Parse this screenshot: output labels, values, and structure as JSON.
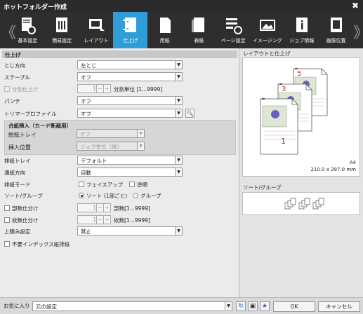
{
  "window": {
    "title": "ホットフォルダー作成",
    "close": "✖"
  },
  "tabs": [
    {
      "label": "基本設定",
      "icon": "basic-settings-icon"
    },
    {
      "label": "簡易設定",
      "icon": "quick-settings-icon"
    },
    {
      "label": "レイアウト",
      "icon": "layout-icon"
    },
    {
      "label": "仕上げ",
      "icon": "finishing-icon",
      "active": true
    },
    {
      "label": "用紙",
      "icon": "paper-icon"
    },
    {
      "label": "表紙",
      "icon": "cover-icon"
    },
    {
      "label": "ページ設定",
      "icon": "page-settings-icon"
    },
    {
      "label": "イメージング",
      "icon": "imaging-icon"
    },
    {
      "label": "ジョブ情報",
      "icon": "job-info-icon"
    },
    {
      "label": "画像位置",
      "icon": "image-position-icon"
    }
  ],
  "nav": {
    "prev": "《",
    "next": "》"
  },
  "section": {
    "title": "仕上げ"
  },
  "fields": {
    "binding": {
      "label": "とじ方向",
      "value": "左とじ"
    },
    "staple": {
      "label": "ステープル",
      "value": "オフ"
    },
    "split": {
      "label": "分割仕上げ",
      "value": "1",
      "minus": "−",
      "plus": "+",
      "unit": "分割単位 [1...9999]"
    },
    "punch": {
      "label": "パンチ",
      "value": "オフ"
    },
    "trimmer": {
      "label": "トリマープロファイル",
      "value": "オフ"
    },
    "interleave": {
      "title": "合紙挿入（カード断裁用）",
      "tray_label": "給紙トレイ",
      "tray_value": "オフ",
      "pos_label": "挿入位置",
      "pos_value": "ジョブ単位（後）"
    },
    "output_tray": {
      "label": "排紙トレイ",
      "value": "デフォルト"
    },
    "paper_dir": {
      "label": "通紙方向",
      "value": "自動"
    },
    "eject_mode": {
      "label": "排紙モード",
      "opt1": "フェイスアップ",
      "opt2": "逆順"
    },
    "sort_group": {
      "label": "ソート/グループ",
      "opt1": "ソート (1部ごと)",
      "opt2": "グループ"
    },
    "copies_split": {
      "label": "部数仕分け",
      "value": "1",
      "minus": "−",
      "plus": "+",
      "unit": "部数[1...9999]"
    },
    "sheets_split": {
      "label": "枚数仕分け",
      "value": "1",
      "minus": "−",
      "plus": "+",
      "unit": "枚数[1...9999]"
    },
    "stacking": {
      "label": "上積み設定",
      "value": "禁止"
    },
    "index_eject": {
      "label": "不要インデックス紙排紙"
    }
  },
  "preview": {
    "title": "レイアウトと仕上げ",
    "size": "A4",
    "dims": "210.0 x 297.0 mm",
    "page_numbers": [
      "5",
      "3",
      "1"
    ],
    "sort_title": "ソート/グループ"
  },
  "bottom": {
    "fav_label": "お気に入り",
    "fav_value": "元の設定",
    "ok": "OK",
    "cancel": "キャンセル"
  },
  "colors": {
    "accent": "#2e9dd8",
    "page_number": "#c03030",
    "toolbar": "#2e2e30"
  }
}
